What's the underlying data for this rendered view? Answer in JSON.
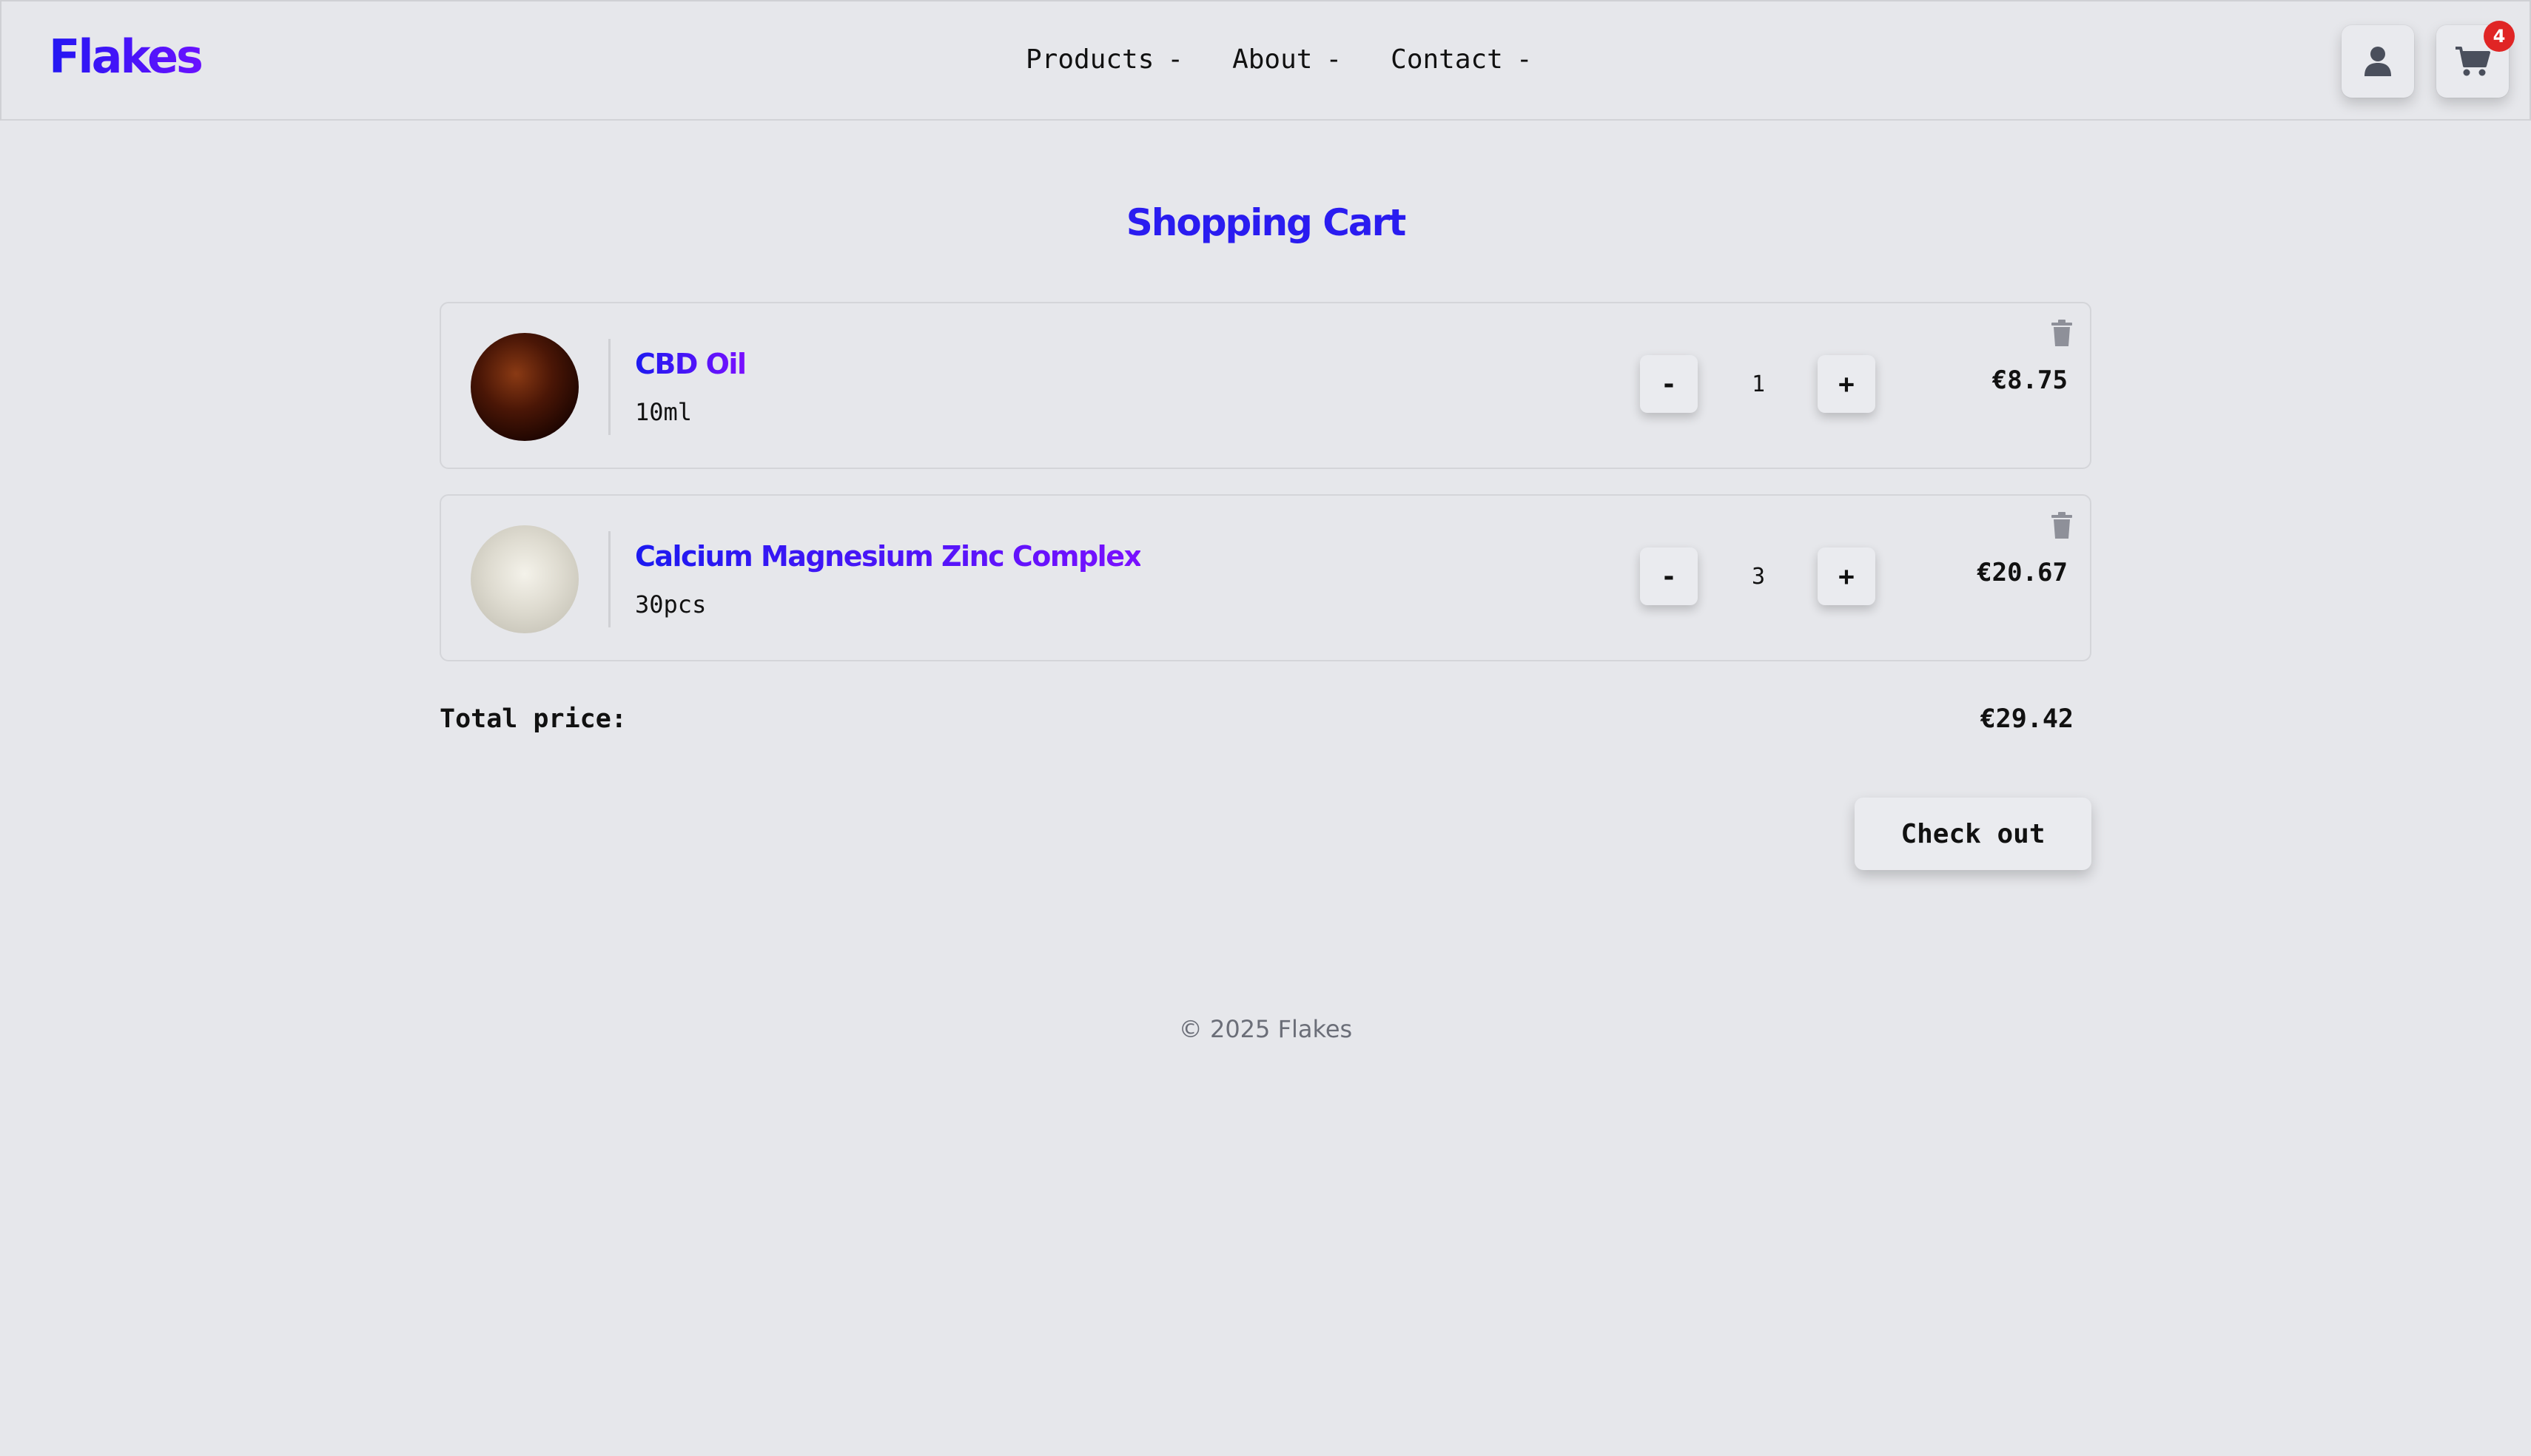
{
  "header": {
    "logo": "Flakes",
    "nav": [
      {
        "label": "Products",
        "caret": "-"
      },
      {
        "label": "About",
        "caret": "-"
      },
      {
        "label": "Contact",
        "caret": "-"
      }
    ],
    "user_icon": "user-icon",
    "cart_icon": "cart-icon",
    "cart_count": "4"
  },
  "page": {
    "title": "Shopping Cart"
  },
  "cart": {
    "items": [
      {
        "name": "CBD Oil",
        "variant": "10ml",
        "quantity": "1",
        "price": "€8.75",
        "minus": "-",
        "plus": "+"
      },
      {
        "name": "Calcium Magnesium Zinc Complex",
        "variant": "30pcs",
        "quantity": "3",
        "price": "€20.67",
        "minus": "-",
        "plus": "+"
      }
    ],
    "total_label": "Total price:",
    "total_value": "€29.42",
    "checkout_label": "Check out"
  },
  "footer": {
    "text": "© 2025 Flakes"
  },
  "colors": {
    "background": "#e6e7eb",
    "brand_start": "#2317f2",
    "brand_end": "#6a11ff",
    "badge": "#e02525",
    "footer_text": "#6b6e78"
  }
}
